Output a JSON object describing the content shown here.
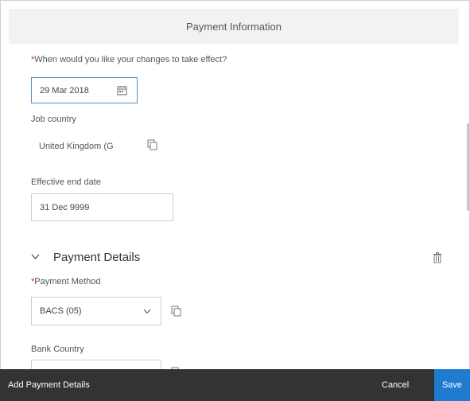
{
  "dialog": {
    "title": "Payment Information"
  },
  "effective": {
    "required_mark": "*",
    "label": "When would you like your changes to take effect?",
    "value": "29 Mar 2018"
  },
  "job_country": {
    "label": "Job country",
    "value": "United Kingdom (G"
  },
  "end_date": {
    "label": "Effective end date",
    "value": "31 Dec 9999"
  },
  "payment_details": {
    "title": "Payment Details",
    "method_required_mark": "*",
    "method_label": "Payment Method",
    "method_value": "BACS (05)",
    "bank_country_label": "Bank Country"
  },
  "footer": {
    "add_label": "Add Payment Details",
    "cancel_label": "Cancel",
    "save_label": "Save"
  },
  "colors": {
    "footer_bg": "#333333",
    "save_bg": "#1f7bd0",
    "required": "#d9232a"
  },
  "icons": [
    "calendar-icon",
    "copy-icon",
    "chevron-down-icon",
    "delete-icon"
  ]
}
